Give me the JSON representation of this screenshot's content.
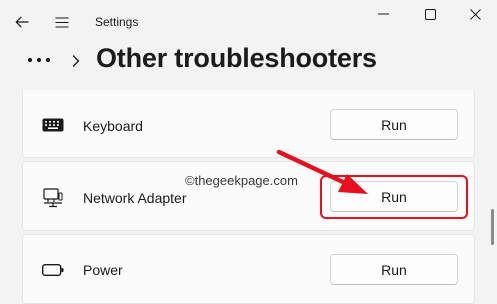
{
  "window": {
    "title": "Settings"
  },
  "header": {
    "more_label": "•••",
    "title": "Other troubleshooters"
  },
  "troubleshooters": [
    {
      "label": "Keyboard",
      "button": "Run",
      "icon": "keyboard-icon"
    },
    {
      "label": "Network Adapter",
      "button": "Run",
      "icon": "network-adapter-icon"
    },
    {
      "label": "Power",
      "button": "Run",
      "icon": "battery-icon"
    }
  ],
  "overlay": {
    "watermark": "©thegeekpage.com",
    "highlight_color": "#e8101e"
  }
}
